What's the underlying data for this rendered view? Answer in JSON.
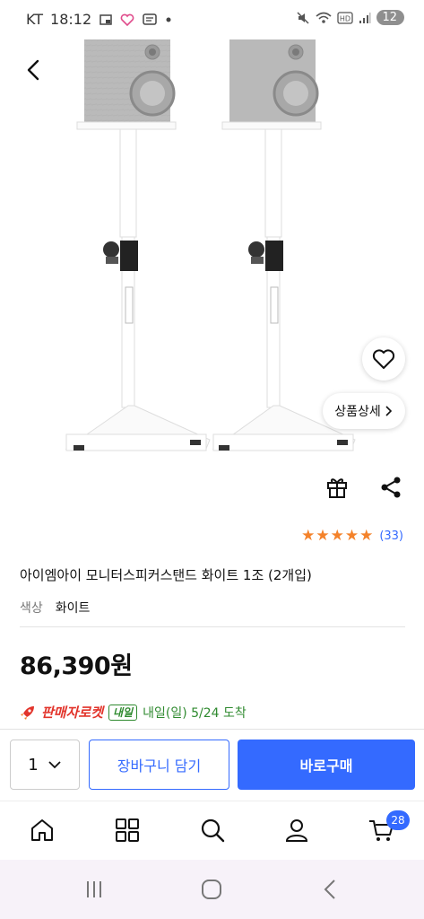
{
  "status_bar": {
    "carrier": "KT",
    "time": "18:12",
    "battery": "12",
    "icons": [
      "picture-in-picture-icon",
      "heart-icon",
      "message-icon",
      "dot-icon",
      "mute-icon",
      "wifi-icon",
      "hd-icon",
      "signal-icon",
      "battery-icon"
    ]
  },
  "product": {
    "image_alt_icons": [
      "back-icon",
      "heart-outline-icon"
    ],
    "detail_label": "상품상세",
    "rating": {
      "stars": 5,
      "review_count": "(33)"
    },
    "title": "아이엠아이 모니터스피커스탠드 화이트 1조 (2개입)",
    "option_label": "색상",
    "option_value": "화이트",
    "price": "86,390원",
    "delivery": {
      "rocket_label": "판매자로켓",
      "badge": "내일",
      "text": "내일(일) 5/24 도착"
    }
  },
  "purchase_bar": {
    "quantity": "1",
    "cart_label": "장바구니 담기",
    "buy_label": "바로구매"
  },
  "bottom_nav": {
    "items": [
      "home-icon",
      "category-icon",
      "search-icon",
      "mypage-icon",
      "cart-icon"
    ],
    "cart_count": "28"
  },
  "colors": {
    "accent": "#346aff",
    "star": "#f4822a",
    "rocket": "#e2342b",
    "delivery": "#2f8a2f"
  }
}
